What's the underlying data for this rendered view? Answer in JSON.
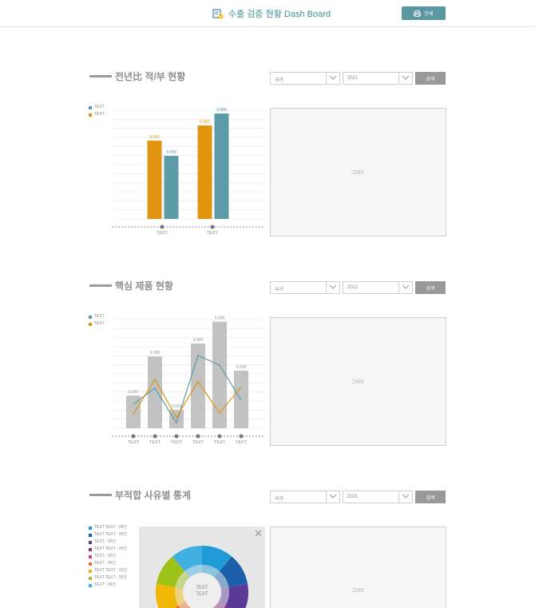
{
  "header": {
    "title": "수출 검증 현황 Dash Board",
    "print_label": "인쇄"
  },
  "sections": [
    {
      "title": "전년比 적/부 현황",
      "country_select": "국가",
      "year_select": "2021",
      "search_label": "검색",
      "grid_label": "그리드",
      "legend": [
        {
          "label": "TEXT",
          "color": "#5b9aa6"
        },
        {
          "label": "TEXT",
          "color": "#e0940f"
        }
      ]
    },
    {
      "title": "핵심 제품 현황",
      "country_select": "국가",
      "year_select": "2021",
      "search_label": "검색",
      "grid_label": "그리드",
      "legend": [
        {
          "label": "TEXT",
          "color": "#5b9aa6"
        },
        {
          "label": "TEXT",
          "color": "#e0940f"
        }
      ]
    },
    {
      "title": "부적합 사유별 통계",
      "country_select": "국가",
      "year_select": "2021",
      "search_label": "검색",
      "grid_label": "그리드",
      "legend": [
        {
          "label": "TEXT TEXT : 00건",
          "color": "#1f9bd7"
        },
        {
          "label": "TEXT TEXT : 00건",
          "color": "#1a5fa8"
        },
        {
          "label": "TEXT : 00건",
          "color": "#5b3a96"
        },
        {
          "label": "TEXT TEXT : 00건",
          "color": "#8a2d7f"
        },
        {
          "label": "TEXT : 00건",
          "color": "#d6368a"
        },
        {
          "label": "TEXT : 00건",
          "color": "#e8701f"
        },
        {
          "label": "TEXT TEXT : 00건",
          "color": "#f2b705"
        },
        {
          "label": "TEXT TEXT : 00건",
          "color": "#9ec21a"
        },
        {
          "label": "TEXT : 00건",
          "color": "#3fb0e0"
        }
      ],
      "pie_center": [
        "TEXT",
        "TEXT"
      ]
    }
  ],
  "chart_data": [
    {
      "type": "bar",
      "categories": [
        "TEXT",
        "TEXT"
      ],
      "series": [
        {
          "name": "TEXT",
          "color": "#e0940f",
          "values": [
            72,
            86
          ],
          "labels": [
            "9.999",
            "9.999"
          ]
        },
        {
          "name": "TEXT",
          "color": "#5b9aa6",
          "values": [
            58,
            97
          ],
          "labels": [
            "9.999",
            "9.999"
          ]
        }
      ],
      "ylim": [
        0,
        100
      ],
      "grid": true
    },
    {
      "type": "bar",
      "categories": [
        "TEXT",
        "TEXT",
        "TEXT",
        "TEXT",
        "TEXT",
        "TEXT"
      ],
      "bars": {
        "color": "#c2c2c2",
        "values": [
          30,
          66,
          17,
          78,
          98,
          53
        ],
        "labels": [
          "9.999",
          "9.999",
          "9.999",
          "9.999",
          "9.999",
          "9.999"
        ]
      },
      "series": [
        {
          "type": "line",
          "color": "#5b9aa6",
          "values": [
            22,
            37,
            5,
            67,
            58,
            26
          ]
        },
        {
          "type": "line",
          "color": "#e0940f",
          "values": [
            13,
            45,
            10,
            43,
            14,
            38
          ]
        }
      ],
      "ylim": [
        0,
        100
      ],
      "grid": true
    },
    {
      "type": "pie",
      "colors": [
        "#1f9bd7",
        "#1a5fa8",
        "#5b3a96",
        "#8a2d7f",
        "#d6368a",
        "#e8701f",
        "#f2b705",
        "#9ec21a",
        "#3fb0e0"
      ],
      "values": [
        1,
        1,
        1,
        1,
        1,
        1,
        1,
        1,
        1
      ]
    }
  ]
}
